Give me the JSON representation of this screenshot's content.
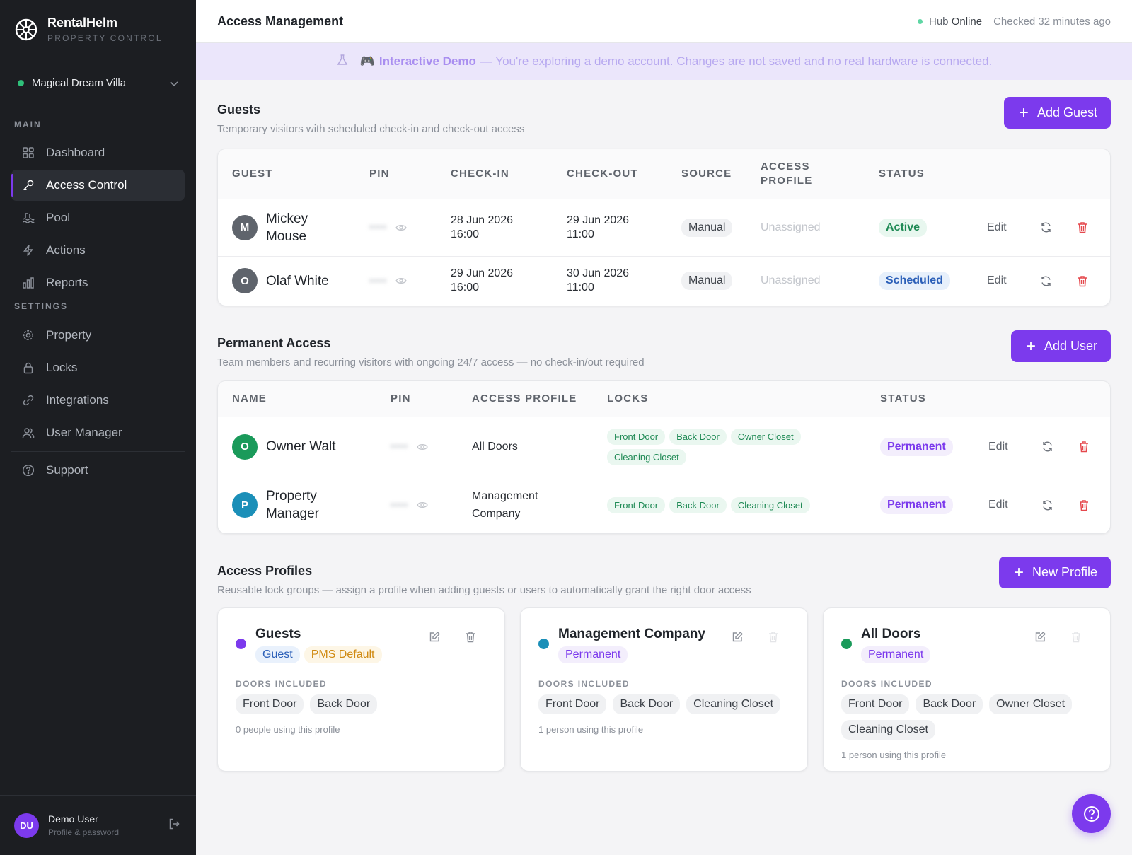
{
  "brand": {
    "name": "RentalHelm",
    "subtitle": "PROPERTY CONTROL"
  },
  "property": {
    "name": "Magical Dream Villa"
  },
  "sidebar": {
    "main_label": "MAIN",
    "settings_label": "SETTINGS",
    "main_items": [
      {
        "label": "Dashboard",
        "icon": "grid-icon"
      },
      {
        "label": "Access Control",
        "icon": "key-icon",
        "active": true
      },
      {
        "label": "Pool",
        "icon": "pool-icon"
      },
      {
        "label": "Actions",
        "icon": "lightning-icon"
      },
      {
        "label": "Reports",
        "icon": "bar-chart-icon"
      }
    ],
    "settings_items": [
      {
        "label": "Property",
        "icon": "gear-icon"
      },
      {
        "label": "Locks",
        "icon": "lock-icon"
      },
      {
        "label": "Integrations",
        "icon": "link-icon"
      },
      {
        "label": "User Manager",
        "icon": "users-icon"
      }
    ],
    "support": {
      "label": "Support",
      "icon": "help-circle-icon"
    }
  },
  "user": {
    "initials": "DU",
    "name": "Demo User",
    "subtitle": "Profile & password"
  },
  "header": {
    "title": "Access Management",
    "hub_label": "Hub",
    "hub_status": "Online",
    "checked": "Checked 32 minutes ago"
  },
  "banner": {
    "emoji": "🎮",
    "strong": "Interactive Demo",
    "text": "— You're exploring a demo account. Changes are not saved and no real hardware is connected."
  },
  "guests": {
    "title": "Guests",
    "subtitle": "Temporary visitors with scheduled check-in and check-out access",
    "add_label": "Add Guest",
    "columns": [
      "GUEST",
      "PIN",
      "CHECK-IN",
      "CHECK-OUT",
      "SOURCE",
      "ACCESS PROFILE",
      "STATUS"
    ],
    "rows": [
      {
        "initial": "M",
        "name": "Mickey Mouse",
        "pin": "••••",
        "checkin_date": "28 Jun 2026",
        "checkin_time": "16:00",
        "checkout_date": "29 Jun 2026",
        "checkout_time": "11:00",
        "source": "Manual",
        "profile": "Unassigned",
        "status": "Active",
        "edit": "Edit"
      },
      {
        "initial": "O",
        "name": "Olaf White",
        "pin": "••••",
        "checkin_date": "29 Jun 2026",
        "checkin_time": "16:00",
        "checkout_date": "30 Jun 2026",
        "checkout_time": "11:00",
        "source": "Manual",
        "profile": "Unassigned",
        "status": "Scheduled",
        "edit": "Edit"
      }
    ]
  },
  "permanent": {
    "title": "Permanent Access",
    "subtitle": "Team members and recurring visitors with ongoing 24/7 access — no check-in/out required",
    "add_label": "Add User",
    "columns": [
      "NAME",
      "PIN",
      "ACCESS PROFILE",
      "LOCKS",
      "STATUS"
    ],
    "rows": [
      {
        "initial": "O",
        "name": "Owner Walt",
        "pin": "••••",
        "profile": "All Doors",
        "locks": [
          "Front Door",
          "Back Door",
          "Owner Closet",
          "Cleaning Closet"
        ],
        "status": "Permanent",
        "edit": "Edit",
        "avatar_color": "#1a9a5a"
      },
      {
        "initial": "P",
        "name": "Property Manager",
        "pin": "••••",
        "profile": "Management Company",
        "locks": [
          "Front Door",
          "Back Door",
          "Cleaning Closet"
        ],
        "status": "Permanent",
        "edit": "Edit",
        "avatar_color": "#1b8fb8"
      }
    ]
  },
  "profiles": {
    "title": "Access Profiles",
    "subtitle": "Reusable lock groups — assign a profile when adding guests or users to automatically grant the right door access",
    "add_label": "New Profile",
    "doors_label": "DOORS INCLUDED",
    "cards": [
      {
        "name": "Guests",
        "dot_color": "#7c3aed",
        "tags": [
          "Guest",
          "PMS Default"
        ],
        "doors": [
          "Front Door",
          "Back Door"
        ],
        "using": "0 people using this profile"
      },
      {
        "name": "Management Company",
        "dot_color": "#1b8fb8",
        "tags": [
          "Permanent"
        ],
        "doors": [
          "Front Door",
          "Back Door",
          "Cleaning Closet"
        ],
        "using": "1 person using this profile"
      },
      {
        "name": "All Doors",
        "dot_color": "#1a9a5a",
        "tags": [
          "Permanent"
        ],
        "doors": [
          "Front Door",
          "Back Door",
          "Owner Closet",
          "Cleaning Closet"
        ],
        "using": "1 person using this profile"
      }
    ]
  },
  "colors": {
    "accent": "#7c3aed",
    "sidebar_bg": "#1c1e22",
    "success": "#1f8a55",
    "danger": "#e5484d"
  }
}
